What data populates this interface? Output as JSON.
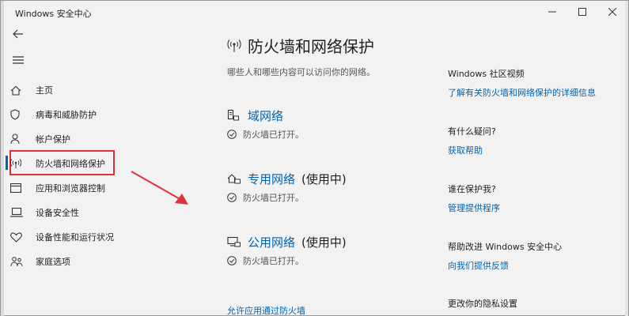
{
  "window": {
    "title": "Windows 安全中心"
  },
  "sidebar": {
    "items": [
      {
        "label": "主页",
        "icon": "home-icon"
      },
      {
        "label": "病毒和威胁防护",
        "icon": "shield-icon"
      },
      {
        "label": "帐户保护",
        "icon": "person-icon"
      },
      {
        "label": "防火墙和网络保护",
        "icon": "wireless-icon",
        "selected": true
      },
      {
        "label": "应用和浏览器控制",
        "icon": "app-window-icon"
      },
      {
        "label": "设备安全性",
        "icon": "laptop-icon"
      },
      {
        "label": "设备性能和运行状况",
        "icon": "heart-icon"
      },
      {
        "label": "家庭选项",
        "icon": "family-icon"
      }
    ]
  },
  "main": {
    "title": "防火墙和网络保护",
    "subtitle": "哪些人和哪些内容可以访问你的网络。",
    "networks": [
      {
        "name": "域网络",
        "tag": "",
        "status": "防火墙已打开。",
        "icon": "domain-network-icon"
      },
      {
        "name": "专用网络",
        "tag": "(使用中)",
        "status": "防火墙已打开。",
        "icon": "private-network-icon"
      },
      {
        "name": "公用网络",
        "tag": "(使用中)",
        "status": "防火墙已打开。",
        "icon": "public-network-icon"
      }
    ],
    "allow_app_link": "允许应用通过防火墙"
  },
  "right_panel": {
    "sections": [
      {
        "heading": "Windows 社区视频",
        "link": "了解有关防火墙和网络保护的详细信息"
      },
      {
        "heading": "有什么疑问?",
        "link": "获取帮助"
      },
      {
        "heading": "谁在保护我?",
        "link": "管理提供程序"
      },
      {
        "heading": "帮助改进 Windows 安全中心",
        "link": "向我们提供反馈"
      },
      {
        "heading": "更改你的隐私设置",
        "link": ""
      }
    ]
  },
  "colors": {
    "accent": "#0063b1",
    "highlight_box": "#e0313a",
    "background": "#f2f2f2"
  }
}
